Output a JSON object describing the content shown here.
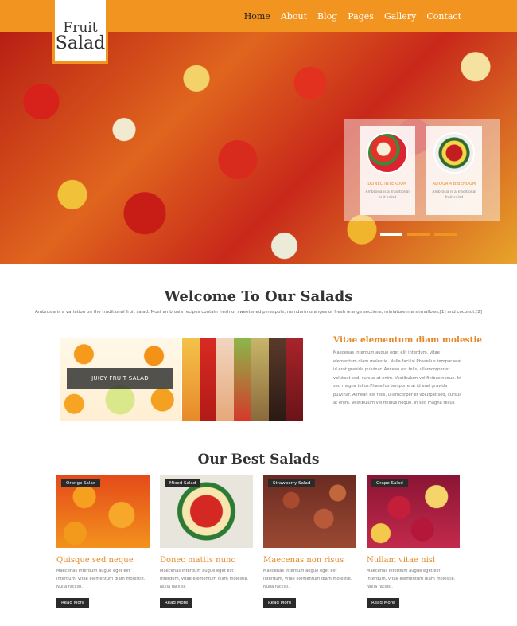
{
  "header": {
    "logo_line1": "Fruit",
    "logo_line2": "Salad",
    "nav": [
      "Home",
      "About",
      "Blog",
      "Pages",
      "Gallery",
      "Contact"
    ],
    "active_nav": "Home",
    "accent_color": "#f29420"
  },
  "hero": {
    "cards": [
      {
        "title": "DONEC INTERDUM",
        "desc": "Ambrosia is a Traditional fruit salad"
      },
      {
        "title": "ALIQUAM BIBENDUM",
        "desc": "Ambrosia is a Traditional fruit salad"
      }
    ],
    "slides_count": 3,
    "active_slide": 1
  },
  "welcome": {
    "title": "Welcome To Our Salads",
    "text": "Ambrosia is a variation on the traditional fruit salad. Most ambrosia recipes contain fresh or sweetened pineapple, mandarin oranges or fresh orange sections, miniature marshmallows,[1] and coconut.[2]"
  },
  "feature": {
    "image_label": "JUICY FRUIT SALAD",
    "heading": "Vitae elementum diam molestie",
    "text": "Maecenas Interdum augue eget elit interdum, vitae elementum diam molestie. Nulla facilisi.Phasellus tempor erat id erat gravida pulvinar. Aenean est felis, ullamcorper et volutpat sed, cursus at enim. Vestibulum vel finibus neque. In sed magna tellus.Phasellus tempor erat id erat gravida pulvinar. Aenean est felis, ullamcorper et volutpat sed, cursus at enim. Vestibulum vel finibus neque. In sed magna tellus"
  },
  "best": {
    "title": "Our Best Salads",
    "cards": [
      {
        "tag": "Orange Salad",
        "title": "Quisque sed neque",
        "desc": "Maecenas Interdum augue eget elit interdum, vitae elementum diam molestie. Nulla facilisi.",
        "button": "Read More"
      },
      {
        "tag": "Mixed Salad",
        "title": "Donec mattis nunc",
        "desc": "Maecenas Interdum augue eget elit interdum, vitae elementum diam molestie. Nulla facilisi.",
        "button": "Read More"
      },
      {
        "tag": "Strawberry Salad",
        "title": "Maecenas non risus",
        "desc": "Maecenas Interdum augue eget elit interdum, vitae elementum diam molestie. Nulla facilisi.",
        "button": "Read More"
      },
      {
        "tag": "Grape Salad",
        "title": "Nullam vitae nisl",
        "desc": "Maecenas Interdum augue eget elit interdum, vitae elementum diam molestie. Nulla facilisi.",
        "button": "Read More"
      }
    ]
  },
  "colors": {
    "accent": "#f29420",
    "heading_orange": "#e58a2a",
    "dark": "#2a2a2a"
  }
}
